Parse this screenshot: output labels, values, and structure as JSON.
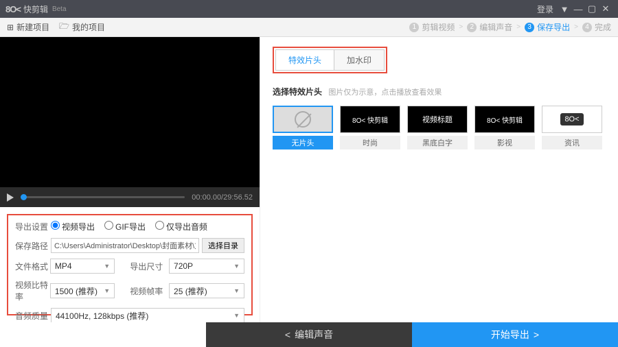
{
  "title": {
    "app_name": "快剪辑",
    "beta": "Beta",
    "logo": "8O<"
  },
  "win": {
    "login": "登录",
    "dropdown": "▼",
    "min": "—",
    "max": "▢",
    "close": "✕"
  },
  "toolbar": {
    "new_project": "新建项目",
    "my_projects": "我的项目",
    "icon_new": "⊞",
    "icon_my": "🗁"
  },
  "steps": {
    "s1": "剪辑视频",
    "s2": "编辑声音",
    "s3": "保存导出",
    "s4": "完成",
    "arrow": ">"
  },
  "player": {
    "time": "00:00.00/29:56.52"
  },
  "export": {
    "settings_label": "导出设置",
    "opt_video": "视频导出",
    "opt_gif": "GIF导出",
    "opt_audio": "仅导出音频",
    "path_label": "保存路径",
    "path_value": "C:\\Users\\Administrator\\Desktop\\封面素材\\方便的视",
    "browse": "选择目录",
    "format_label": "文件格式",
    "format_value": "MP4",
    "size_label": "导出尺寸",
    "size_value": "720P",
    "bitrate_label": "视频比特率",
    "bitrate_value": "1500 (推荐)",
    "fps_label": "视频帧率",
    "fps_value": "25 (推荐)",
    "audio_label": "音频质量",
    "audio_value": "44100Hz, 128kbps (推荐)"
  },
  "tabs": {
    "t1": "特效片头",
    "t2": "加水印"
  },
  "section": {
    "title": "选择特效片头",
    "hint": "图片仅为示意，点击播放查看效果"
  },
  "thumbs": [
    {
      "label": "无片头",
      "preview": ""
    },
    {
      "label": "时尚",
      "preview": "8O< 快剪辑"
    },
    {
      "label": "黑底白字",
      "preview": "视频标题"
    },
    {
      "label": "影视",
      "preview": "8O< 快剪辑"
    },
    {
      "label": "资讯",
      "preview": "8O<"
    }
  ],
  "footer": {
    "back": "编辑声音",
    "export": "开始导出",
    "lt": "<",
    "gt": ">"
  }
}
